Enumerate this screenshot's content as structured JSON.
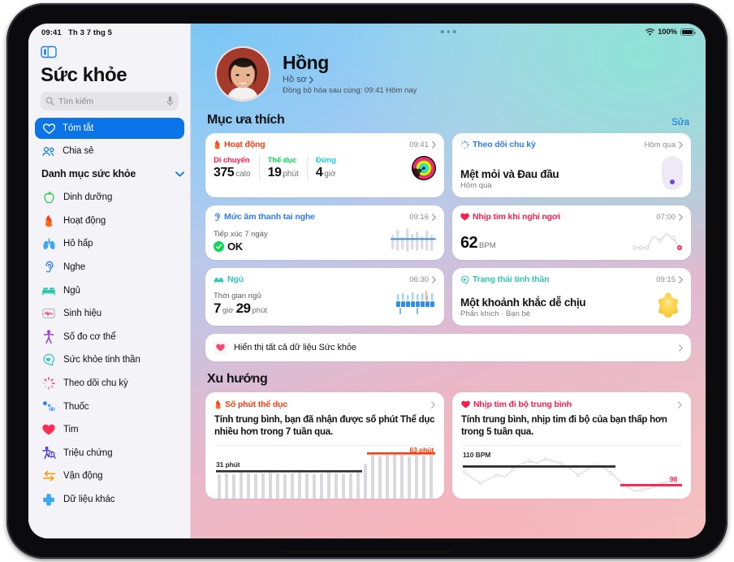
{
  "status_bar": {
    "time": "09:41",
    "date": "Th 3 7 thg 5",
    "battery_percent": "100%",
    "wifi_icon": "wifi-icon",
    "battery_icon": "battery-icon"
  },
  "sidebar": {
    "toggle_icon": "sidebar-toggle-icon",
    "title": "Sức khỏe",
    "search": {
      "placeholder": "Tìm kiếm",
      "icon": "search-icon",
      "mic_icon": "microphone-icon"
    },
    "nav": [
      {
        "label": "Tóm tắt",
        "icon": "heart-icon",
        "active": true
      },
      {
        "label": "Chia sẻ",
        "icon": "people-icon",
        "active": false
      }
    ],
    "categories_header": {
      "label": "Danh mục sức khỏe",
      "chevron_icon": "chevron-down-icon"
    },
    "categories": [
      {
        "label": "Dinh dưỡng",
        "icon": "apple-icon",
        "color": "#34c759"
      },
      {
        "label": "Hoạt động",
        "icon": "flame-icon",
        "color": "#ff3b0f"
      },
      {
        "label": "Hô hấp",
        "icon": "lungs-icon",
        "color": "#3aa8f5"
      },
      {
        "label": "Nghe",
        "icon": "ear-icon",
        "color": "#2f7bf6"
      },
      {
        "label": "Ngủ",
        "icon": "bed-icon",
        "color": "#30c8b0"
      },
      {
        "label": "Sinh hiệu",
        "icon": "vitals-icon",
        "color": "#ff2d55"
      },
      {
        "label": "Số đo cơ thể",
        "icon": "body-icon",
        "color": "#9a35e8"
      },
      {
        "label": "Sức khỏe tinh thần",
        "icon": "mind-icon",
        "color": "#30c8b0"
      },
      {
        "label": "Theo dõi chu kỳ",
        "icon": "cycle-icon",
        "color": "#f0386b"
      },
      {
        "label": "Thuốc",
        "icon": "pills-icon",
        "color": "#2f7bf6"
      },
      {
        "label": "Tim",
        "icon": "heart-filled-icon",
        "color": "#ff2d55"
      },
      {
        "label": "Triệu chứng",
        "icon": "symptoms-icon",
        "color": "#4b3ce0"
      },
      {
        "label": "Vận động",
        "icon": "mobility-icon",
        "color": "#ff9500"
      },
      {
        "label": "Dữ liệu khác",
        "icon": "other-data-icon",
        "color": "#3aa8f5"
      }
    ]
  },
  "profile": {
    "name": "Hồng",
    "link_label": "Hồ sơ",
    "link_chevron": "chevron-right-icon",
    "sync_text": "Đồng bộ hóa sau cùng: 09:41 Hôm nay",
    "avatar": "avatar"
  },
  "favorites": {
    "title": "Mục ưa thích",
    "edit_label": "Sửa",
    "cards": [
      {
        "name": "activity-card",
        "title": "Hoạt động",
        "icon": "flame-icon",
        "title_color": "#ff3b0f",
        "time": "09:41",
        "stats": [
          {
            "label": "Di chuyển",
            "color": "#fa1e4e",
            "value": "375",
            "unit": "calo"
          },
          {
            "label": "Thể dục",
            "color": "#0bd855",
            "value": "19",
            "unit": "phút"
          },
          {
            "label": "Đứng",
            "color": "#20cde0",
            "value": "4",
            "unit": "giờ"
          }
        ],
        "rings_icon": "activity-rings-icon"
      },
      {
        "name": "cycle-tracking-card",
        "title": "Theo dõi chu kỳ",
        "icon": "cycle-icon",
        "title_color": "#2f7bf6",
        "time": "Hôm qua",
        "headline": "Mệt mỏi và Đau đầu",
        "sub": "Hôm qua",
        "viz": "cycle-pill-indicator"
      },
      {
        "name": "headphone-audio-card",
        "title": "Mức âm thanh tai nghe",
        "icon": "ear-icon",
        "title_color": "#2f7bf6",
        "time": "09:16",
        "label": "Tiếp xúc 7 ngày",
        "status": "OK",
        "status_icon": "check-circle-icon",
        "viz": "audio-bars-chart"
      },
      {
        "name": "resting-heart-rate-card",
        "title": "Nhịp tim khi nghỉ ngơi",
        "icon": "heart-filled-icon",
        "title_color": "#fa1e4e",
        "time": "07:00",
        "value": "62",
        "unit": "BPM",
        "viz": "heart-rate-line-chart"
      },
      {
        "name": "sleep-card",
        "title": "Ngủ",
        "icon": "bed-icon",
        "title_color": "#30c8b0",
        "time": "06:30",
        "label": "Thời gian ngủ",
        "hours": "7",
        "hours_unit": "giờ",
        "minutes": "29",
        "minutes_unit": "phút",
        "viz": "sleep-bars-chart"
      },
      {
        "name": "state-of-mind-card",
        "title": "Trạng thái tinh thần",
        "icon": "mind-icon",
        "title_color": "#30c8b0",
        "time": "09:15",
        "headline": "Một khoảnh khắc dễ chịu",
        "sub": "Phấn khích · Bạn bè",
        "viz": "star-shape-icon"
      }
    ],
    "show_all": {
      "label": "Hiển thị tất cả dữ liệu Sức khỏe",
      "icon": "heart-filled-icon",
      "chevron": "chevron-right-icon"
    }
  },
  "trends": {
    "title": "Xu hướng",
    "cards": [
      {
        "name": "exercise-minutes-trend",
        "title": "Số phút thể dục",
        "icon": "flame-icon",
        "title_color": "#ff3b0f",
        "description": "Tính trung bình, bạn đã nhận được số phút Thể dục nhiều hơn trong 7 tuần qua.",
        "baseline_label": "31 phút",
        "current_label": "63 phút"
      },
      {
        "name": "walking-heart-rate-trend",
        "title": "Nhịp tim đi bộ trung bình",
        "icon": "heart-filled-icon",
        "title_color": "#fa1e4e",
        "description": "Tính trung bình, nhịp tim đi bộ của bạn thấp hơn trong 5 tuần qua.",
        "baseline_label": "110 BPM",
        "current_label": "98"
      }
    ]
  },
  "chart_data": [
    {
      "type": "bar",
      "name": "exercise-minutes-trend",
      "title": "Số phút thể dục",
      "ylabel": "phút",
      "baseline": 31,
      "current": 63,
      "values": [
        30,
        31,
        30,
        32,
        31,
        30,
        31,
        32,
        31,
        30,
        31,
        32,
        31,
        30,
        31,
        32,
        31,
        30,
        31,
        32,
        48,
        63,
        62,
        63,
        64,
        63,
        62,
        63
      ],
      "baseline_label": "31 phút",
      "current_label": "63 phút"
    },
    {
      "type": "line",
      "name": "walking-heart-rate-trend",
      "title": "Nhịp tim đi bộ trung bình",
      "ylabel": "BPM",
      "baseline": 110,
      "current": 98,
      "values": [
        106,
        100,
        97,
        101,
        104,
        103,
        107,
        110,
        112,
        111,
        113,
        112,
        111,
        108,
        104,
        107,
        110,
        109,
        106,
        101,
        96,
        92,
        93,
        94,
        97,
        98
      ],
      "baseline_label": "110 BPM",
      "current_label": "98"
    },
    {
      "type": "bar",
      "name": "headphone-audio-chart",
      "title": "Mức âm thanh tai nghe",
      "values": [
        38,
        62,
        30,
        72,
        40,
        58,
        34,
        66,
        44,
        54
      ],
      "threshold": 50
    },
    {
      "type": "bar",
      "name": "sleep-stages-chart",
      "title": "Ngủ",
      "values": [
        40,
        55,
        48,
        62,
        50,
        58,
        45,
        60,
        52,
        44
      ]
    },
    {
      "type": "line",
      "name": "resting-heart-rate-chart",
      "title": "Nhịp tim khi nghỉ ngơi",
      "values": [
        58,
        58,
        58,
        58,
        70,
        80,
        76,
        82,
        80,
        62
      ]
    }
  ]
}
